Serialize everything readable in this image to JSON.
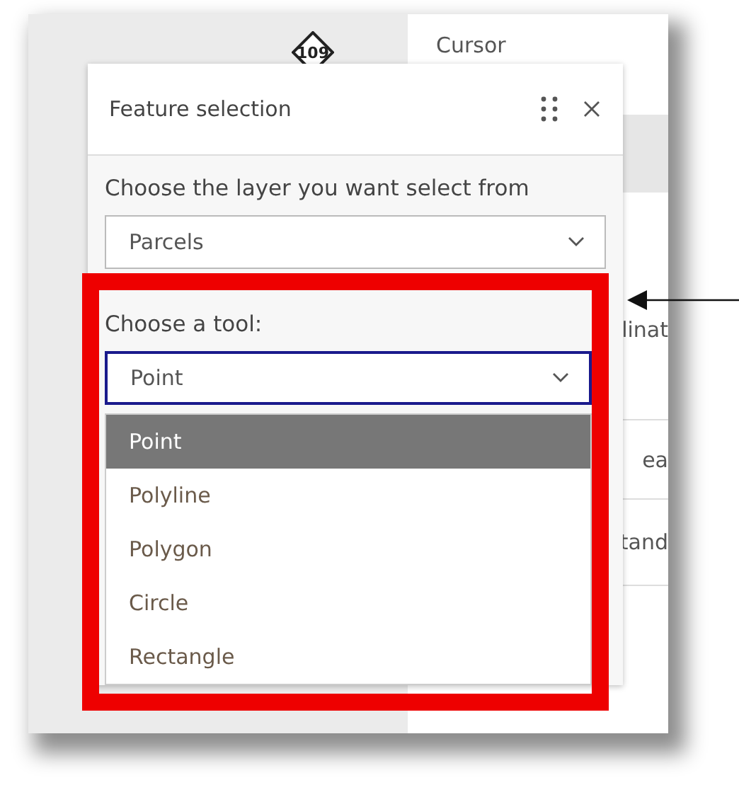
{
  "map": {
    "route_badge": "109"
  },
  "side_panel": {
    "items": [
      {
        "label": "Cursor"
      },
      {
        "label": "linat"
      },
      {
        "label": "ea"
      },
      {
        "label": "tand"
      }
    ]
  },
  "dialog": {
    "title": "Feature selection",
    "layer_label": "Choose the layer you want select from",
    "layer_select": {
      "value": "Parcels"
    },
    "tool_label": "Choose a tool:",
    "tool_select": {
      "value": "Point",
      "open": true
    },
    "tool_options": [
      {
        "label": "Point",
        "selected": true
      },
      {
        "label": "Polyline",
        "selected": false
      },
      {
        "label": "Polygon",
        "selected": false
      },
      {
        "label": "Circle",
        "selected": false
      },
      {
        "label": "Rectangle",
        "selected": false
      }
    ]
  }
}
